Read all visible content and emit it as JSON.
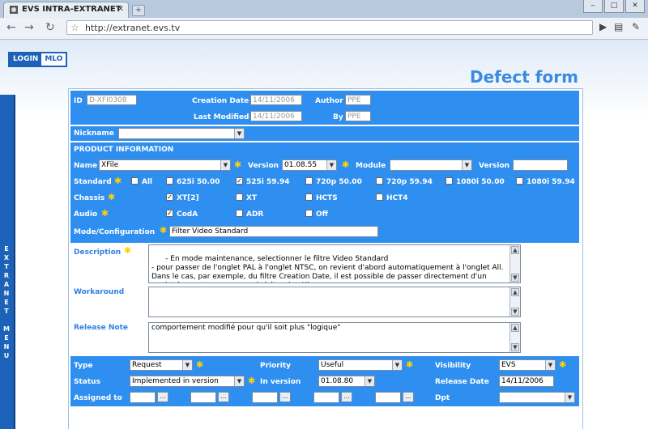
{
  "browser": {
    "tab_title": "EVS INTRA-EXTRANET",
    "url": "http://extranet.evs.tv"
  },
  "page": {
    "login_label": "LOGIN",
    "mlo_label": "MLO",
    "sidebar_text": "EXTRANET MENU",
    "form_title": "Defect form"
  },
  "header": {
    "id_label": "ID",
    "id_value": "D-XFI0308",
    "creation_date_label": "Creation Date",
    "creation_date_value": "14/11/2006",
    "author_label": "Author",
    "author_value": "PPE",
    "last_modified_label": "Last Modified",
    "last_modified_value": "14/11/2006",
    "by_label": "By",
    "by_value": "PPE"
  },
  "nickname": {
    "label": "Nickname",
    "value": ""
  },
  "product": {
    "section_title": "PRODUCT INFORMATION",
    "name_label": "Name",
    "name_value": "XFile",
    "version_label": "Version",
    "version_value": "01.08.55",
    "module_label": "Module",
    "module_value": "",
    "version2_label": "Version",
    "version2_value": "",
    "standard_label": "Standard",
    "standards": [
      {
        "label": "All",
        "checked": false
      },
      {
        "label": "625i 50.00",
        "checked": false
      },
      {
        "label": "525i 59.94",
        "checked": true
      },
      {
        "label": "720p 50.00",
        "checked": false
      },
      {
        "label": "720p 59.94",
        "checked": false
      },
      {
        "label": "1080i 50.00",
        "checked": false
      },
      {
        "label": "1080i 59.94",
        "checked": false
      }
    ],
    "chassis_label": "Chassis",
    "chassis": [
      {
        "label": "XT[2]",
        "checked": true
      },
      {
        "label": "XT",
        "checked": false
      },
      {
        "label": "HCTS",
        "checked": false
      },
      {
        "label": "HCT4",
        "checked": false
      }
    ],
    "audio_label": "Audio",
    "audio": [
      {
        "label": "CodA",
        "checked": true
      },
      {
        "label": "ADR",
        "checked": false
      },
      {
        "label": "Off",
        "checked": false
      }
    ],
    "mode_label": "Mode/Configuration",
    "mode_value": "Filter Video Standard"
  },
  "description": {
    "label": "Description",
    "text": "- En mode maintenance, selectionner le filtre Video Standard\n- pour passer de l'onglet PAL à l'onglet NTSC, on revient d'abord automatiquement à l'onglet All. Dans le cas, par exemple, du filtre Creation Date, il est possible de passer directement d'un onglet à un autre sans revenir à l'onglet All."
  },
  "workaround": {
    "label": "Workaround",
    "text": ""
  },
  "release_note": {
    "label": "Release Note",
    "text": "comportement modifié pour qu'il soit plus \"logique\""
  },
  "status": {
    "type_label": "Type",
    "type_value": "Request",
    "priority_label": "Priority",
    "priority_value": "Useful",
    "visibility_label": "Visibility",
    "visibility_value": "EVS",
    "status_label": "Status",
    "status_value": "Implemented in version",
    "in_version_label": "In version",
    "in_version_value": "01.08.80",
    "release_date_label": "Release Date",
    "release_date_value": "14/11/2006",
    "assigned_label": "Assigned to",
    "dpt_label": "Dpt",
    "dpt_value": "",
    "dots": "..."
  },
  "colors": {
    "form_blue": "#2f8ff0",
    "title_blue": "#3a8be0",
    "sidebar_blue": "#1c62b8",
    "required_star": "#ffd200"
  }
}
